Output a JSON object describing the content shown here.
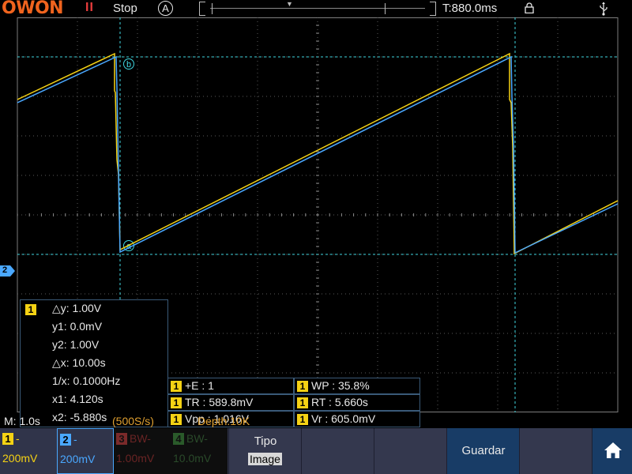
{
  "topbar": {
    "logo": "OWON",
    "run_icon": "II",
    "run_state": "Stop",
    "trigger_mode": "A",
    "time_offset": "T:880.0ms",
    "icons": [
      "lock-icon",
      "usb-icon"
    ]
  },
  "cursors": {
    "labels": {
      "a": "b",
      "b": "a"
    },
    "channel": "1",
    "dy": "△y: 1.00V",
    "y1": "y1: 0.0mV",
    "y2": "y2: 1.00V",
    "dx": "△x: 10.00s",
    "inv_dx": "1/x: 0.1000Hz",
    "x1": "x1: 4.120s",
    "x2": "x2: -5.880s"
  },
  "measurements": [
    {
      "channel": "1",
      "text": "+E : 1"
    },
    {
      "channel": "1",
      "text": "WP : 35.8%"
    },
    {
      "channel": "1",
      "text": "TR : 589.8mV"
    },
    {
      "channel": "1",
      "text": "RT : 5.660s"
    },
    {
      "channel": "1",
      "text": "Vpp : 1.016V"
    },
    {
      "channel": "1",
      "text": "Vr : 605.0mV"
    }
  ],
  "channel_marker": "2",
  "status": {
    "timebase": "M: 1.0s",
    "sample_rate": "(500S/s)",
    "depth": "Depth:10K"
  },
  "channels": [
    {
      "num": "1",
      "coupling": "-",
      "scale": "200mV",
      "color": "#f5d214"
    },
    {
      "num": "2",
      "coupling": "-",
      "scale": "200mV",
      "color": "#4aa8ff"
    },
    {
      "num": "3",
      "coupling": "BW-",
      "scale": "1.00mV",
      "color": "#7a2a2a"
    },
    {
      "num": "4",
      "coupling": "BW-",
      "scale": "10.0mV",
      "color": "#2a5a2a"
    }
  ],
  "softkeys": {
    "tipo_label": "Tipo",
    "tipo_value": "Image",
    "guardar_label": "Guardar",
    "home_icon": "home-icon"
  },
  "colors": {
    "ch1": "#f5d214",
    "ch2": "#4aa8ff",
    "cursor": "#3fd6e0",
    "grid": "#7d7d7d"
  }
}
